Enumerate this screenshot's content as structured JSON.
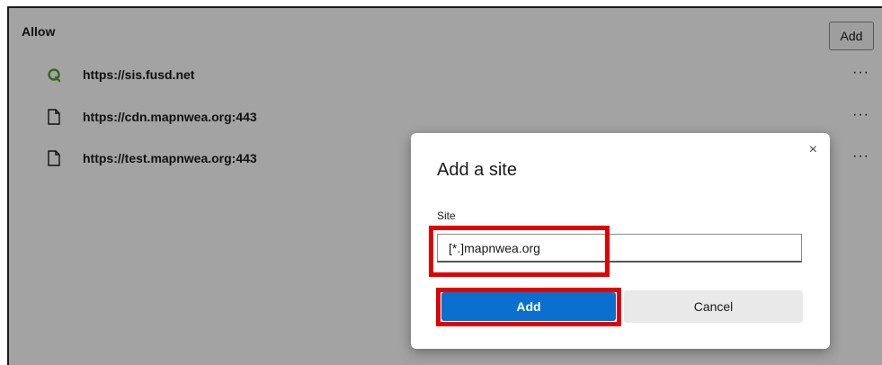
{
  "section": {
    "title": "Allow",
    "add_label": "Add"
  },
  "sites": [
    {
      "icon": "site-logo-icon",
      "url": "https://sis.fusd.net",
      "more": "···"
    },
    {
      "icon": "page-icon",
      "url": "https://cdn.mapnwea.org:443",
      "more": "···"
    },
    {
      "icon": "page-icon",
      "url": "https://test.mapnwea.org:443",
      "more": "···"
    }
  ],
  "dialog": {
    "title": "Add a site",
    "close": "×",
    "field_label": "Site",
    "field_value": "[*.]mapnwea.org",
    "add_label": "Add",
    "cancel_label": "Cancel"
  },
  "colors": {
    "accent": "#0a6fce",
    "highlight": "#e30000",
    "logo": "#5aa02c"
  }
}
